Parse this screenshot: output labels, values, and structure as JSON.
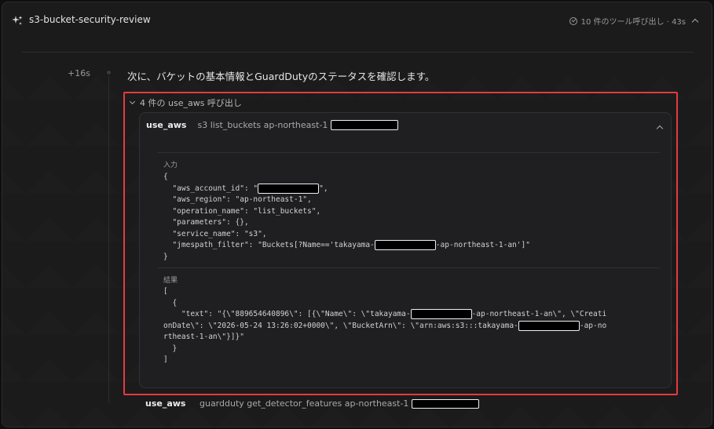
{
  "header": {
    "title": "s3-bucket-security-review",
    "status": "10 件のツール呼び出し · 43s"
  },
  "step": {
    "time": "+16s",
    "message": "次に、バケットの基本情報とGuardDutyのステータスを確認します。"
  },
  "calls": {
    "toggle_label": "4 件の use_aws 呼び出し",
    "items": [
      {
        "tool": "use_aws",
        "operation": "s3 list_buckets ap-northeast-1",
        "input_label": "入力",
        "input_lines": {
          "open": "{",
          "account": "  \"aws_account_id\": \"",
          "account_end": "\",",
          "region": "  \"aws_region\": \"ap-northeast-1\",",
          "operation": "  \"operation_name\": \"list_buckets\",",
          "params": "  \"parameters\": {},",
          "service": "  \"service_name\": \"s3\",",
          "jmes_start": "  \"jmespath_filter\": \"Buckets[?Name=='takayama-",
          "jmes_end": "-ap-northeast-1-an']\"",
          "close": "}"
        },
        "result_label": "結果",
        "result_lines": {
          "l1": "[",
          "l2": "  {",
          "l3a": "    \"text\": \"{\\\"889654640896\\\": [{\\\"Name\\\": \\\"takayama-",
          "l3b": "-ap-northeast-1-an\\\", \\\"Creati",
          "l4": "onDate\\\": \\\"2026-05-24 13:26:02+0000\\\", \\\"BucketArn\\\": \\\"arn:aws:s3:::takayama-",
          "l4b": "-ap-no",
          "l5": "rtheast-1-an\\\"}]}\"",
          "l6": "  }",
          "l7": "]"
        }
      },
      {
        "tool": "use_aws",
        "operation": "guardduty get_detector_features ap-northeast-1"
      }
    ]
  }
}
